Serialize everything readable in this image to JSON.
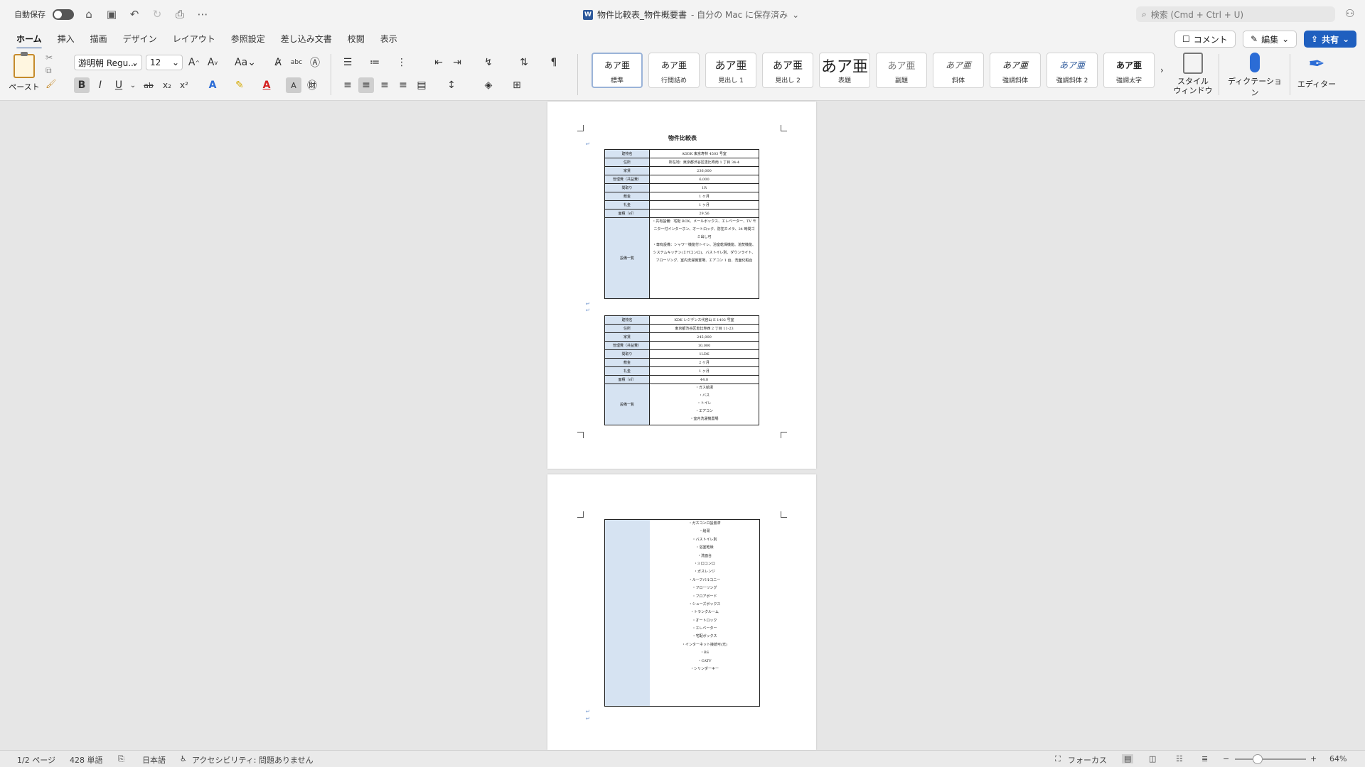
{
  "titlebar": {
    "autosave": "自動保存",
    "doc_name": "物件比較表_物件概要書",
    "save_state": " - 自分の Mac に保存済み",
    "search_placeholder": "検索 (Cmd + Ctrl + U)"
  },
  "tabs": [
    "ホーム",
    "挿入",
    "描画",
    "デザイン",
    "レイアウト",
    "参照設定",
    "差し込み文書",
    "校閲",
    "表示"
  ],
  "actions": {
    "comment": "コメント",
    "edit": "編集",
    "share": "共有"
  },
  "toolbar": {
    "paste": "ペースト",
    "font_name": "游明朝 Regu...",
    "font_size": "12",
    "aa": "Aa",
    "styles": [
      {
        "preview": "あア亜",
        "name": "標準"
      },
      {
        "preview": "あア亜",
        "name": "行間詰め"
      },
      {
        "preview": "あア亜",
        "name": "見出し 1"
      },
      {
        "preview": "あア亜",
        "name": "見出し 2"
      },
      {
        "preview": "あア亜",
        "name": "表題"
      },
      {
        "preview": "あア亜",
        "name": "副題"
      },
      {
        "preview": "あア亜",
        "name": "斜体"
      },
      {
        "preview": "あア亜",
        "name": "強調斜体"
      },
      {
        "preview": "あア亜",
        "name": "強調斜体 2"
      },
      {
        "preview": "あア亜",
        "name": "強調太字"
      }
    ],
    "style_window": "スタイル\nウィンドウ",
    "dictation": "ディクテーション",
    "editor": "エディター"
  },
  "document": {
    "title": "物件比較表",
    "table1": {
      "rows": [
        {
          "label": "建物名",
          "value": "ADDK 東京寿林 4503 号室"
        },
        {
          "label": "住所",
          "value": "所在地：東京都渋谷区恵比寿南 1 丁目 34-4"
        },
        {
          "label": "家賃",
          "value": "236,000"
        },
        {
          "label": "管理費（共益費）",
          "value": "6,000"
        },
        {
          "label": "間取り",
          "value": "1R"
        },
        {
          "label": "敷金",
          "value": "1 ヶ月"
        },
        {
          "label": "礼金",
          "value": "1 ヶ月"
        },
        {
          "label": "面積（㎡）",
          "value": "29.56"
        }
      ],
      "facility_label": "設備一覧",
      "facility_lines": [
        "・共有設備：宅配 BOX、メールボックス、エレベーター、TV モ",
        "ニター付インターホン、オートロック、防犯カメラ、24 時間ゴ",
        "ミ出し可",
        "・専有設備：シャワー機能付トイレ、浴室乾燥機能、追焚機能、",
        "システムキッチン(ＩＨコンロ)、バストイレ別、ダウンライト、",
        "フローリング、室内洗濯機置場、エアコン 1 台、洗面化粧台"
      ]
    },
    "table2": {
      "rows": [
        {
          "label": "建物名",
          "value": "KDK レジデンス代官山 E 1402 号室"
        },
        {
          "label": "住所",
          "value": "東京都渋谷区恵比寿西 2 丁目 11-23"
        },
        {
          "label": "家賃",
          "value": "245,000"
        },
        {
          "label": "管理費（共益費）",
          "value": "10,000"
        },
        {
          "label": "間取り",
          "value": "1LDK"
        },
        {
          "label": "敷金",
          "value": "2 ヶ月"
        },
        {
          "label": "礼金",
          "value": "1 ヶ月"
        },
        {
          "label": "面積（㎡）",
          "value": "44.8"
        }
      ],
      "facility_label": "設備一覧",
      "facility_lines": [
        "・ガス給湯",
        "・バス",
        "・トイレ",
        "・エアコン",
        "・室内洗濯機置場"
      ],
      "continued_lines": [
        "・ガスコンロ設置済",
        "・給湯",
        "・バストイレ別",
        "・浴室乾燥",
        "・洗面台",
        "・3 口コンロ",
        "・ガスレンジ",
        "・ルーフバルコニー",
        "・フローリング",
        "・フロアボード",
        "・シューズボックス",
        "・トランクルーム",
        "・オートロック",
        "・エレベーター",
        "・宅配ボックス",
        "・インターネット接続可(光)",
        "・BS",
        "・CATV",
        "・シリンダーキー"
      ]
    }
  },
  "status": {
    "page": "1/2 ページ",
    "words": "428 単語",
    "language": "日本語",
    "accessibility": "アクセシビリティ: 問題ありません",
    "focus": "フォーカス",
    "zoom": "64%",
    "zoom_level": 0.64
  }
}
